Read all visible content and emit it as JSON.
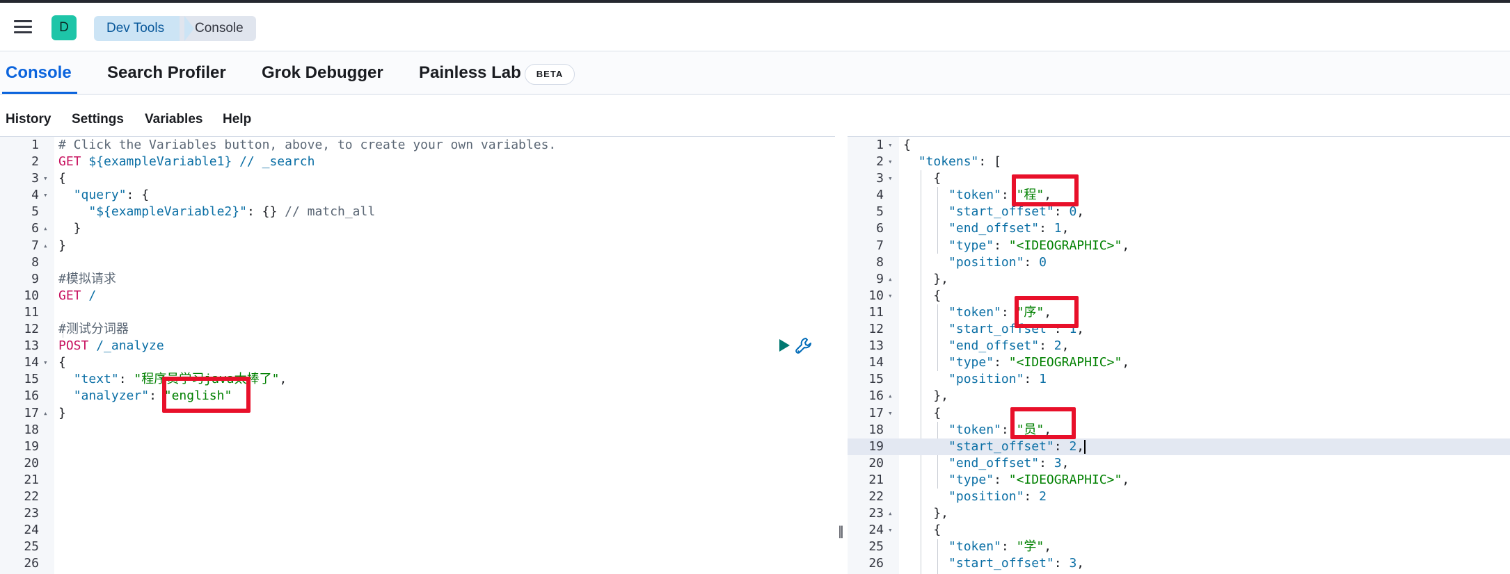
{
  "header": {
    "avatar_letter": "D",
    "breadcrumbs": [
      "Dev Tools",
      "Console"
    ]
  },
  "app_tabs": {
    "console": "Console",
    "search_profiler": "Search Profiler",
    "grok_debugger": "Grok Debugger",
    "painless_lab": "Painless Lab",
    "beta_badge": "BETA"
  },
  "menu": {
    "history": "History",
    "settings": "Settings",
    "variables": "Variables",
    "help": "Help"
  },
  "request_editor": {
    "lines": [
      {
        "n": "1",
        "fold": "",
        "code": [
          [
            "c-com",
            "# Click the Variables button, above, to create your own variables."
          ]
        ]
      },
      {
        "n": "2",
        "fold": "",
        "code": [
          [
            "c-kw",
            "GET"
          ],
          [
            "c-pun",
            " "
          ],
          [
            "c-url",
            "${exampleVariable1} // _search"
          ]
        ]
      },
      {
        "n": "3",
        "fold": "▾",
        "code": [
          [
            "c-pun",
            "{"
          ]
        ]
      },
      {
        "n": "4",
        "fold": "▾",
        "code": [
          [
            "c-pun",
            "  "
          ],
          [
            "c-key",
            "\"query\""
          ],
          [
            "c-pun",
            ": {"
          ]
        ]
      },
      {
        "n": "5",
        "fold": "",
        "code": [
          [
            "c-pun",
            "    "
          ],
          [
            "c-key",
            "\"${exampleVariable2}\""
          ],
          [
            "c-pun",
            ": {} "
          ],
          [
            "c-com",
            "// match_all"
          ]
        ]
      },
      {
        "n": "6",
        "fold": "▴",
        "code": [
          [
            "c-pun",
            "  }"
          ]
        ]
      },
      {
        "n": "7",
        "fold": "▴",
        "code": [
          [
            "c-pun",
            "}"
          ]
        ]
      },
      {
        "n": "8",
        "fold": "",
        "code": []
      },
      {
        "n": "9",
        "fold": "",
        "code": [
          [
            "c-com",
            "#模拟请求"
          ]
        ]
      },
      {
        "n": "10",
        "fold": "",
        "code": [
          [
            "c-kw",
            "GET"
          ],
          [
            "c-pun",
            " "
          ],
          [
            "c-url",
            "/"
          ]
        ]
      },
      {
        "n": "11",
        "fold": "",
        "code": []
      },
      {
        "n": "12",
        "fold": "",
        "code": [
          [
            "c-com",
            "#测试分词器"
          ]
        ]
      },
      {
        "n": "13",
        "fold": "",
        "code": [
          [
            "c-kw",
            "POST"
          ],
          [
            "c-pun",
            " "
          ],
          [
            "c-url",
            "/_analyze"
          ]
        ]
      },
      {
        "n": "14",
        "fold": "▾",
        "code": [
          [
            "c-pun",
            "{"
          ]
        ]
      },
      {
        "n": "15",
        "fold": "",
        "code": [
          [
            "c-pun",
            "  "
          ],
          [
            "c-key",
            "\"text\""
          ],
          [
            "c-pun",
            ": "
          ],
          [
            "c-str",
            "\"程序员学习java太棒了\""
          ],
          [
            "c-pun",
            ","
          ]
        ]
      },
      {
        "n": "16",
        "fold": "",
        "code": [
          [
            "c-pun",
            "  "
          ],
          [
            "c-key",
            "\"analyzer\""
          ],
          [
            "c-pun",
            ": "
          ],
          [
            "c-str",
            "\"english\""
          ]
        ]
      },
      {
        "n": "17",
        "fold": "▴",
        "code": [
          [
            "c-pun",
            "}"
          ]
        ]
      },
      {
        "n": "18",
        "fold": "",
        "code": []
      },
      {
        "n": "19",
        "fold": "",
        "code": []
      },
      {
        "n": "20",
        "fold": "",
        "code": []
      },
      {
        "n": "21",
        "fold": "",
        "code": []
      },
      {
        "n": "22",
        "fold": "",
        "code": []
      },
      {
        "n": "23",
        "fold": "",
        "code": []
      },
      {
        "n": "24",
        "fold": "",
        "code": []
      },
      {
        "n": "25",
        "fold": "",
        "code": []
      },
      {
        "n": "26",
        "fold": "",
        "code": []
      }
    ]
  },
  "response_editor": {
    "highlight_line": "19",
    "lines": [
      {
        "n": "1",
        "fold": "▾",
        "code": [
          [
            "c-pun",
            "{"
          ]
        ]
      },
      {
        "n": "2",
        "fold": "▾",
        "code": [
          [
            "c-pun",
            "  "
          ],
          [
            "c-key",
            "\"tokens\""
          ],
          [
            "c-pun",
            ": ["
          ]
        ]
      },
      {
        "n": "3",
        "fold": "▾",
        "code": [
          [
            "c-pun",
            "    {"
          ]
        ]
      },
      {
        "n": "4",
        "fold": "",
        "code": [
          [
            "c-pun",
            "      "
          ],
          [
            "c-key",
            "\"token\""
          ],
          [
            "c-pun",
            ": "
          ],
          [
            "c-str",
            "\"程\""
          ],
          [
            "c-pun",
            ","
          ]
        ]
      },
      {
        "n": "5",
        "fold": "",
        "code": [
          [
            "c-pun",
            "      "
          ],
          [
            "c-key",
            "\"start_offset\""
          ],
          [
            "c-pun",
            ": "
          ],
          [
            "c-num",
            "0"
          ],
          [
            "c-pun",
            ","
          ]
        ]
      },
      {
        "n": "6",
        "fold": "",
        "code": [
          [
            "c-pun",
            "      "
          ],
          [
            "c-key",
            "\"end_offset\""
          ],
          [
            "c-pun",
            ": "
          ],
          [
            "c-num",
            "1"
          ],
          [
            "c-pun",
            ","
          ]
        ]
      },
      {
        "n": "7",
        "fold": "",
        "code": [
          [
            "c-pun",
            "      "
          ],
          [
            "c-key",
            "\"type\""
          ],
          [
            "c-pun",
            ": "
          ],
          [
            "c-str",
            "\"<IDEOGRAPHIC>\""
          ],
          [
            "c-pun",
            ","
          ]
        ]
      },
      {
        "n": "8",
        "fold": "",
        "code": [
          [
            "c-pun",
            "      "
          ],
          [
            "c-key",
            "\"position\""
          ],
          [
            "c-pun",
            ": "
          ],
          [
            "c-num",
            "0"
          ]
        ]
      },
      {
        "n": "9",
        "fold": "▴",
        "code": [
          [
            "c-pun",
            "    },"
          ]
        ]
      },
      {
        "n": "10",
        "fold": "▾",
        "code": [
          [
            "c-pun",
            "    {"
          ]
        ]
      },
      {
        "n": "11",
        "fold": "",
        "code": [
          [
            "c-pun",
            "      "
          ],
          [
            "c-key",
            "\"token\""
          ],
          [
            "c-pun",
            ": "
          ],
          [
            "c-str",
            "\"序\""
          ],
          [
            "c-pun",
            ","
          ]
        ]
      },
      {
        "n": "12",
        "fold": "",
        "code": [
          [
            "c-pun",
            "      "
          ],
          [
            "c-key",
            "\"start_offset\""
          ],
          [
            "c-pun",
            ": "
          ],
          [
            "c-num",
            "1"
          ],
          [
            "c-pun",
            ","
          ]
        ]
      },
      {
        "n": "13",
        "fold": "",
        "code": [
          [
            "c-pun",
            "      "
          ],
          [
            "c-key",
            "\"end_offset\""
          ],
          [
            "c-pun",
            ": "
          ],
          [
            "c-num",
            "2"
          ],
          [
            "c-pun",
            ","
          ]
        ]
      },
      {
        "n": "14",
        "fold": "",
        "code": [
          [
            "c-pun",
            "      "
          ],
          [
            "c-key",
            "\"type\""
          ],
          [
            "c-pun",
            ": "
          ],
          [
            "c-str",
            "\"<IDEOGRAPHIC>\""
          ],
          [
            "c-pun",
            ","
          ]
        ]
      },
      {
        "n": "15",
        "fold": "",
        "code": [
          [
            "c-pun",
            "      "
          ],
          [
            "c-key",
            "\"position\""
          ],
          [
            "c-pun",
            ": "
          ],
          [
            "c-num",
            "1"
          ]
        ]
      },
      {
        "n": "16",
        "fold": "▴",
        "code": [
          [
            "c-pun",
            "    },"
          ]
        ]
      },
      {
        "n": "17",
        "fold": "▾",
        "code": [
          [
            "c-pun",
            "    {"
          ]
        ]
      },
      {
        "n": "18",
        "fold": "",
        "code": [
          [
            "c-pun",
            "      "
          ],
          [
            "c-key",
            "\"token\""
          ],
          [
            "c-pun",
            ": "
          ],
          [
            "c-str",
            "\"员\""
          ],
          [
            "c-pun",
            ","
          ]
        ]
      },
      {
        "n": "19",
        "fold": "",
        "code": [
          [
            "c-pun",
            "      "
          ],
          [
            "c-key",
            "\"start_offset\""
          ],
          [
            "c-pun",
            ": "
          ],
          [
            "c-num",
            "2"
          ],
          [
            "c-pun",
            ","
          ]
        ]
      },
      {
        "n": "20",
        "fold": "",
        "code": [
          [
            "c-pun",
            "      "
          ],
          [
            "c-key",
            "\"end_offset\""
          ],
          [
            "c-pun",
            ": "
          ],
          [
            "c-num",
            "3"
          ],
          [
            "c-pun",
            ","
          ]
        ]
      },
      {
        "n": "21",
        "fold": "",
        "code": [
          [
            "c-pun",
            "      "
          ],
          [
            "c-key",
            "\"type\""
          ],
          [
            "c-pun",
            ": "
          ],
          [
            "c-str",
            "\"<IDEOGRAPHIC>\""
          ],
          [
            "c-pun",
            ","
          ]
        ]
      },
      {
        "n": "22",
        "fold": "",
        "code": [
          [
            "c-pun",
            "      "
          ],
          [
            "c-key",
            "\"position\""
          ],
          [
            "c-pun",
            ": "
          ],
          [
            "c-num",
            "2"
          ]
        ]
      },
      {
        "n": "23",
        "fold": "▴",
        "code": [
          [
            "c-pun",
            "    },"
          ]
        ]
      },
      {
        "n": "24",
        "fold": "▾",
        "code": [
          [
            "c-pun",
            "    {"
          ]
        ]
      },
      {
        "n": "25",
        "fold": "",
        "code": [
          [
            "c-pun",
            "      "
          ],
          [
            "c-key",
            "\"token\""
          ],
          [
            "c-pun",
            ": "
          ],
          [
            "c-str",
            "\"学\""
          ],
          [
            "c-pun",
            ","
          ]
        ]
      },
      {
        "n": "26",
        "fold": "",
        "code": [
          [
            "c-pun",
            "      "
          ],
          [
            "c-key",
            "\"start_offset\""
          ],
          [
            "c-pun",
            ": "
          ],
          [
            "c-num",
            "3"
          ],
          [
            "c-pun",
            ","
          ]
        ]
      }
    ]
  },
  "icons": {
    "menu": "hamburger-icon",
    "run": "play-icon",
    "wrench": "wrench-icon",
    "resize": "resize-grip-icon"
  },
  "colors": {
    "accent": "#0b64dd",
    "annotation_red": "#e8102a",
    "avatar": "#1ec5a8",
    "keyword": "#c7105e",
    "string": "#008000"
  }
}
